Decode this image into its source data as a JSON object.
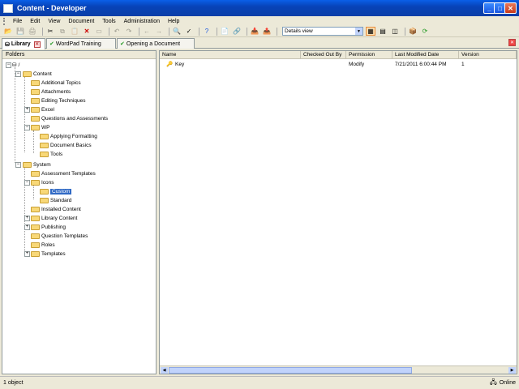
{
  "window": {
    "title": "Content - Developer",
    "buttons": {
      "minimize": "_",
      "maximize": "□",
      "close": "✕"
    }
  },
  "menu": {
    "items": [
      "File",
      "Edit",
      "View",
      "Document",
      "Tools",
      "Administration",
      "Help"
    ]
  },
  "toolbar": {
    "view_select": "Details view"
  },
  "tabs": [
    {
      "label": "Library",
      "active": true
    },
    {
      "label": "WordPad Training"
    },
    {
      "label": "Opening a Document"
    }
  ],
  "folders": {
    "header": "Folders",
    "root": "/",
    "items": [
      {
        "label": "Content"
      },
      {
        "label": "Additional Topics"
      },
      {
        "label": "Attachments"
      },
      {
        "label": "Editing Techniques"
      },
      {
        "label": "Excel"
      },
      {
        "label": "Questions and Assessments"
      },
      {
        "label": "WP"
      },
      {
        "label": "Applying Formatting"
      },
      {
        "label": "Document Basics"
      },
      {
        "label": "Tools"
      },
      {
        "label": "System"
      },
      {
        "label": "Assessment Templates"
      },
      {
        "label": "Icons"
      },
      {
        "label": "Custom"
      },
      {
        "label": "Standard"
      },
      {
        "label": "Installed Content"
      },
      {
        "label": "Library Content"
      },
      {
        "label": "Publishing"
      },
      {
        "label": "Question Templates"
      },
      {
        "label": "Roles"
      },
      {
        "label": "Templates"
      }
    ]
  },
  "details": {
    "columns": [
      "Name",
      "Checked Out By",
      "Permission",
      "Last Modified Date",
      "Version"
    ],
    "rows": [
      {
        "name": "Key",
        "checked_out_by": "",
        "permission": "Modify",
        "modified": "7/21/2011 6:00:44 PM",
        "version": "1"
      }
    ]
  },
  "status": {
    "left": "1 object",
    "right": "Online"
  }
}
